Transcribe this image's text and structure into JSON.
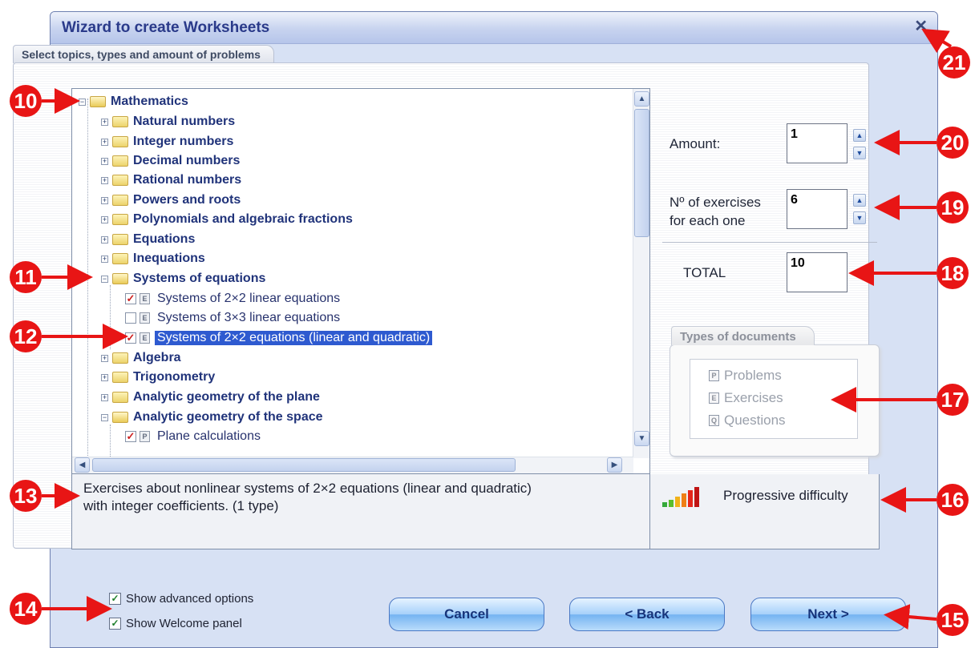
{
  "window": {
    "title": "Wizard to create Worksheets",
    "close_symbol": "✕"
  },
  "tab_label": "Select topics, types and amount of problems",
  "tree": {
    "root": "Mathematics",
    "categories": [
      "Natural numbers",
      "Integer numbers",
      "Decimal numbers",
      "Rational numbers",
      "Powers and roots",
      "Polynomials and algebraic fractions",
      "Equations",
      "Inequations"
    ],
    "expanded_category": "Systems of equations",
    "leaves": [
      {
        "label": "Systems of 2×2 linear equations",
        "type": "E",
        "checked": true
      },
      {
        "label": "Systems of 3×3 linear equations",
        "type": "E",
        "checked": false
      },
      {
        "label": "Systems of 2×2 equations (linear and quadratic)",
        "type": "E",
        "checked": true,
        "selected": true
      }
    ],
    "categories_after": [
      "Algebra",
      "Trigonometry",
      "Analytic geometry of the plane"
    ],
    "expanded_category_2": "Analytic geometry of the space",
    "leaves_2": [
      {
        "label": "Plane calculations",
        "type": "P",
        "checked": true
      }
    ]
  },
  "amount": {
    "label": "Amount:",
    "value": "1"
  },
  "exercises": {
    "label_line1": "Nº of exercises",
    "label_line2": "for each one",
    "value": "6"
  },
  "total": {
    "label": "TOTAL",
    "value": "10"
  },
  "types_of_documents": {
    "title": "Types of documents",
    "items": [
      {
        "code": "P",
        "label": "Problems"
      },
      {
        "code": "E",
        "label": "Exercises"
      },
      {
        "code": "Q",
        "label": "Questions"
      }
    ]
  },
  "description": {
    "line1": "Exercises about nonlinear systems of 2×2 equations (linear and quadratic)",
    "line2": "with integer coefficients. (1 type)"
  },
  "difficulty_label": "Progressive difficulty",
  "options": {
    "show_advanced": {
      "label": "Show advanced options",
      "checked": true
    },
    "show_welcome": {
      "label": "Show Welcome panel",
      "checked": true
    }
  },
  "buttons": {
    "cancel": "Cancel",
    "back": "< Back",
    "next": "Next >"
  },
  "callouts": [
    "10",
    "11",
    "12",
    "13",
    "14",
    "15",
    "16",
    "17",
    "18",
    "19",
    "20",
    "21"
  ],
  "colors": {
    "callout_red": "#e81515",
    "selection_blue": "#2e5ad0",
    "title_blue": "#2a3a8a"
  }
}
